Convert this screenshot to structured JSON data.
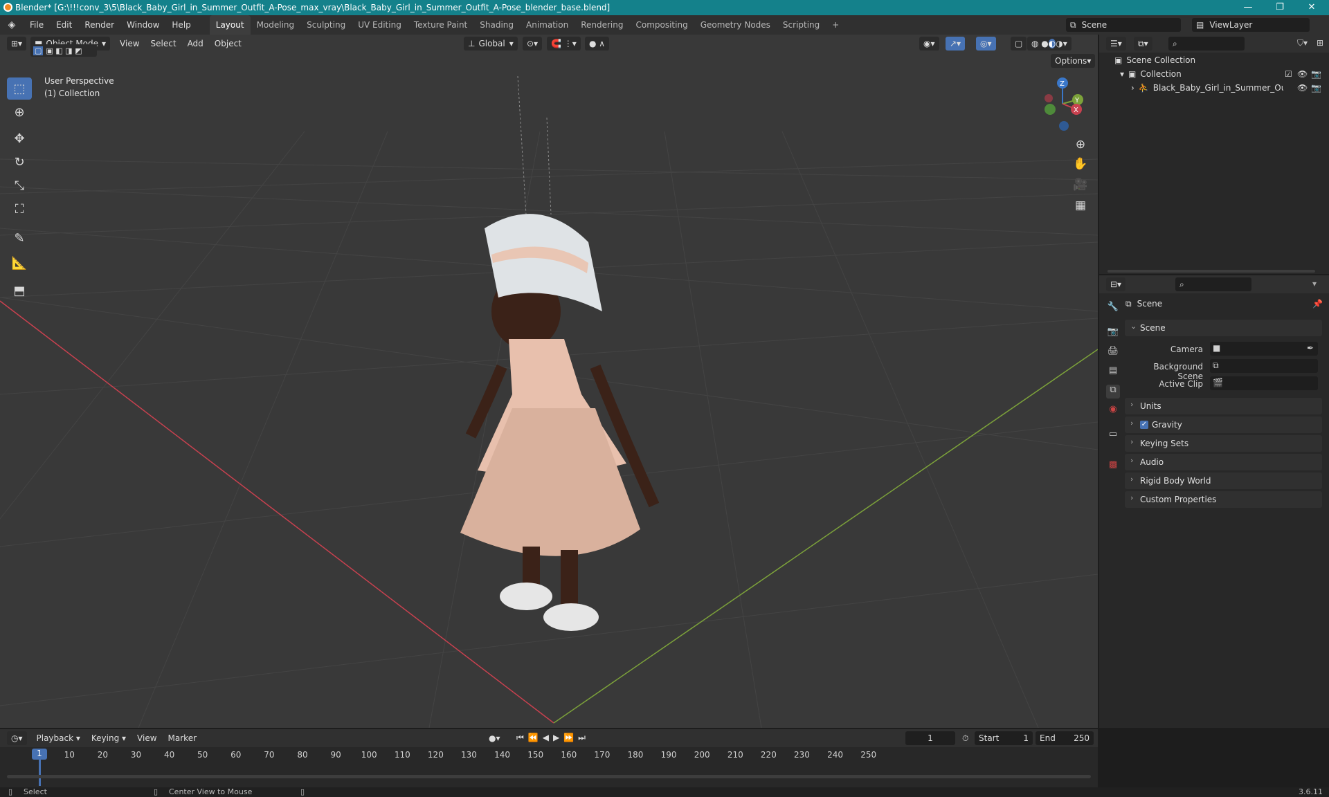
{
  "titlebar": {
    "title": "Blender* [G:\\!!!conv_3\\5\\Black_Baby_Girl_in_Summer_Outfit_A-Pose_max_vray\\Black_Baby_Girl_in_Summer_Outfit_A-Pose_blender_base.blend]",
    "min": "—",
    "max": "❐",
    "close": "✕"
  },
  "menu": [
    "File",
    "Edit",
    "Render",
    "Window",
    "Help"
  ],
  "workspaces": [
    "Layout",
    "Modeling",
    "Sculpting",
    "UV Editing",
    "Texture Paint",
    "Shading",
    "Animation",
    "Rendering",
    "Compositing",
    "Geometry Nodes",
    "Scripting",
    "+"
  ],
  "scene_field": "Scene",
  "viewlayer_field": "ViewLayer",
  "viewport": {
    "mode": "Object Mode",
    "menus": [
      "View",
      "Select",
      "Add",
      "Object"
    ],
    "transform": "Global",
    "options": "Options",
    "info_line1": "User Perspective",
    "info_line2": "(1) Collection"
  },
  "gizmo": {
    "z": "Z",
    "y": "Y",
    "x": "X"
  },
  "outliner": {
    "root": "Scene Collection",
    "collection": "Collection",
    "object": "Black_Baby_Girl_in_Summer_Outfit"
  },
  "properties": {
    "header": "Scene",
    "section": "Scene",
    "camera_label": "Camera",
    "bg_label": "Background Scene",
    "clip_label": "Active Clip",
    "panels": [
      "Units",
      "Gravity",
      "Keying Sets",
      "Audio",
      "Rigid Body World",
      "Custom Properties"
    ]
  },
  "timeline": {
    "menus": [
      "Playback",
      "Keying",
      "View",
      "Marker"
    ],
    "current_frame": "1",
    "start_label": "Start",
    "start": "1",
    "end_label": "End",
    "end": "250",
    "ticks": [
      "1",
      "10",
      "20",
      "30",
      "40",
      "50",
      "60",
      "70",
      "80",
      "90",
      "100",
      "110",
      "120",
      "130",
      "140",
      "150",
      "160",
      "170",
      "180",
      "190",
      "200",
      "210",
      "220",
      "230",
      "240",
      "250"
    ]
  },
  "status": {
    "select": "Select",
    "center": "Center View to Mouse",
    "version": "3.6.11"
  },
  "colors": {
    "accent": "#4772b3",
    "titlebar": "#14818b",
    "x_axis": "#c8414f",
    "y_axis": "#7ca23a",
    "z_axis": "#3a77c9"
  }
}
